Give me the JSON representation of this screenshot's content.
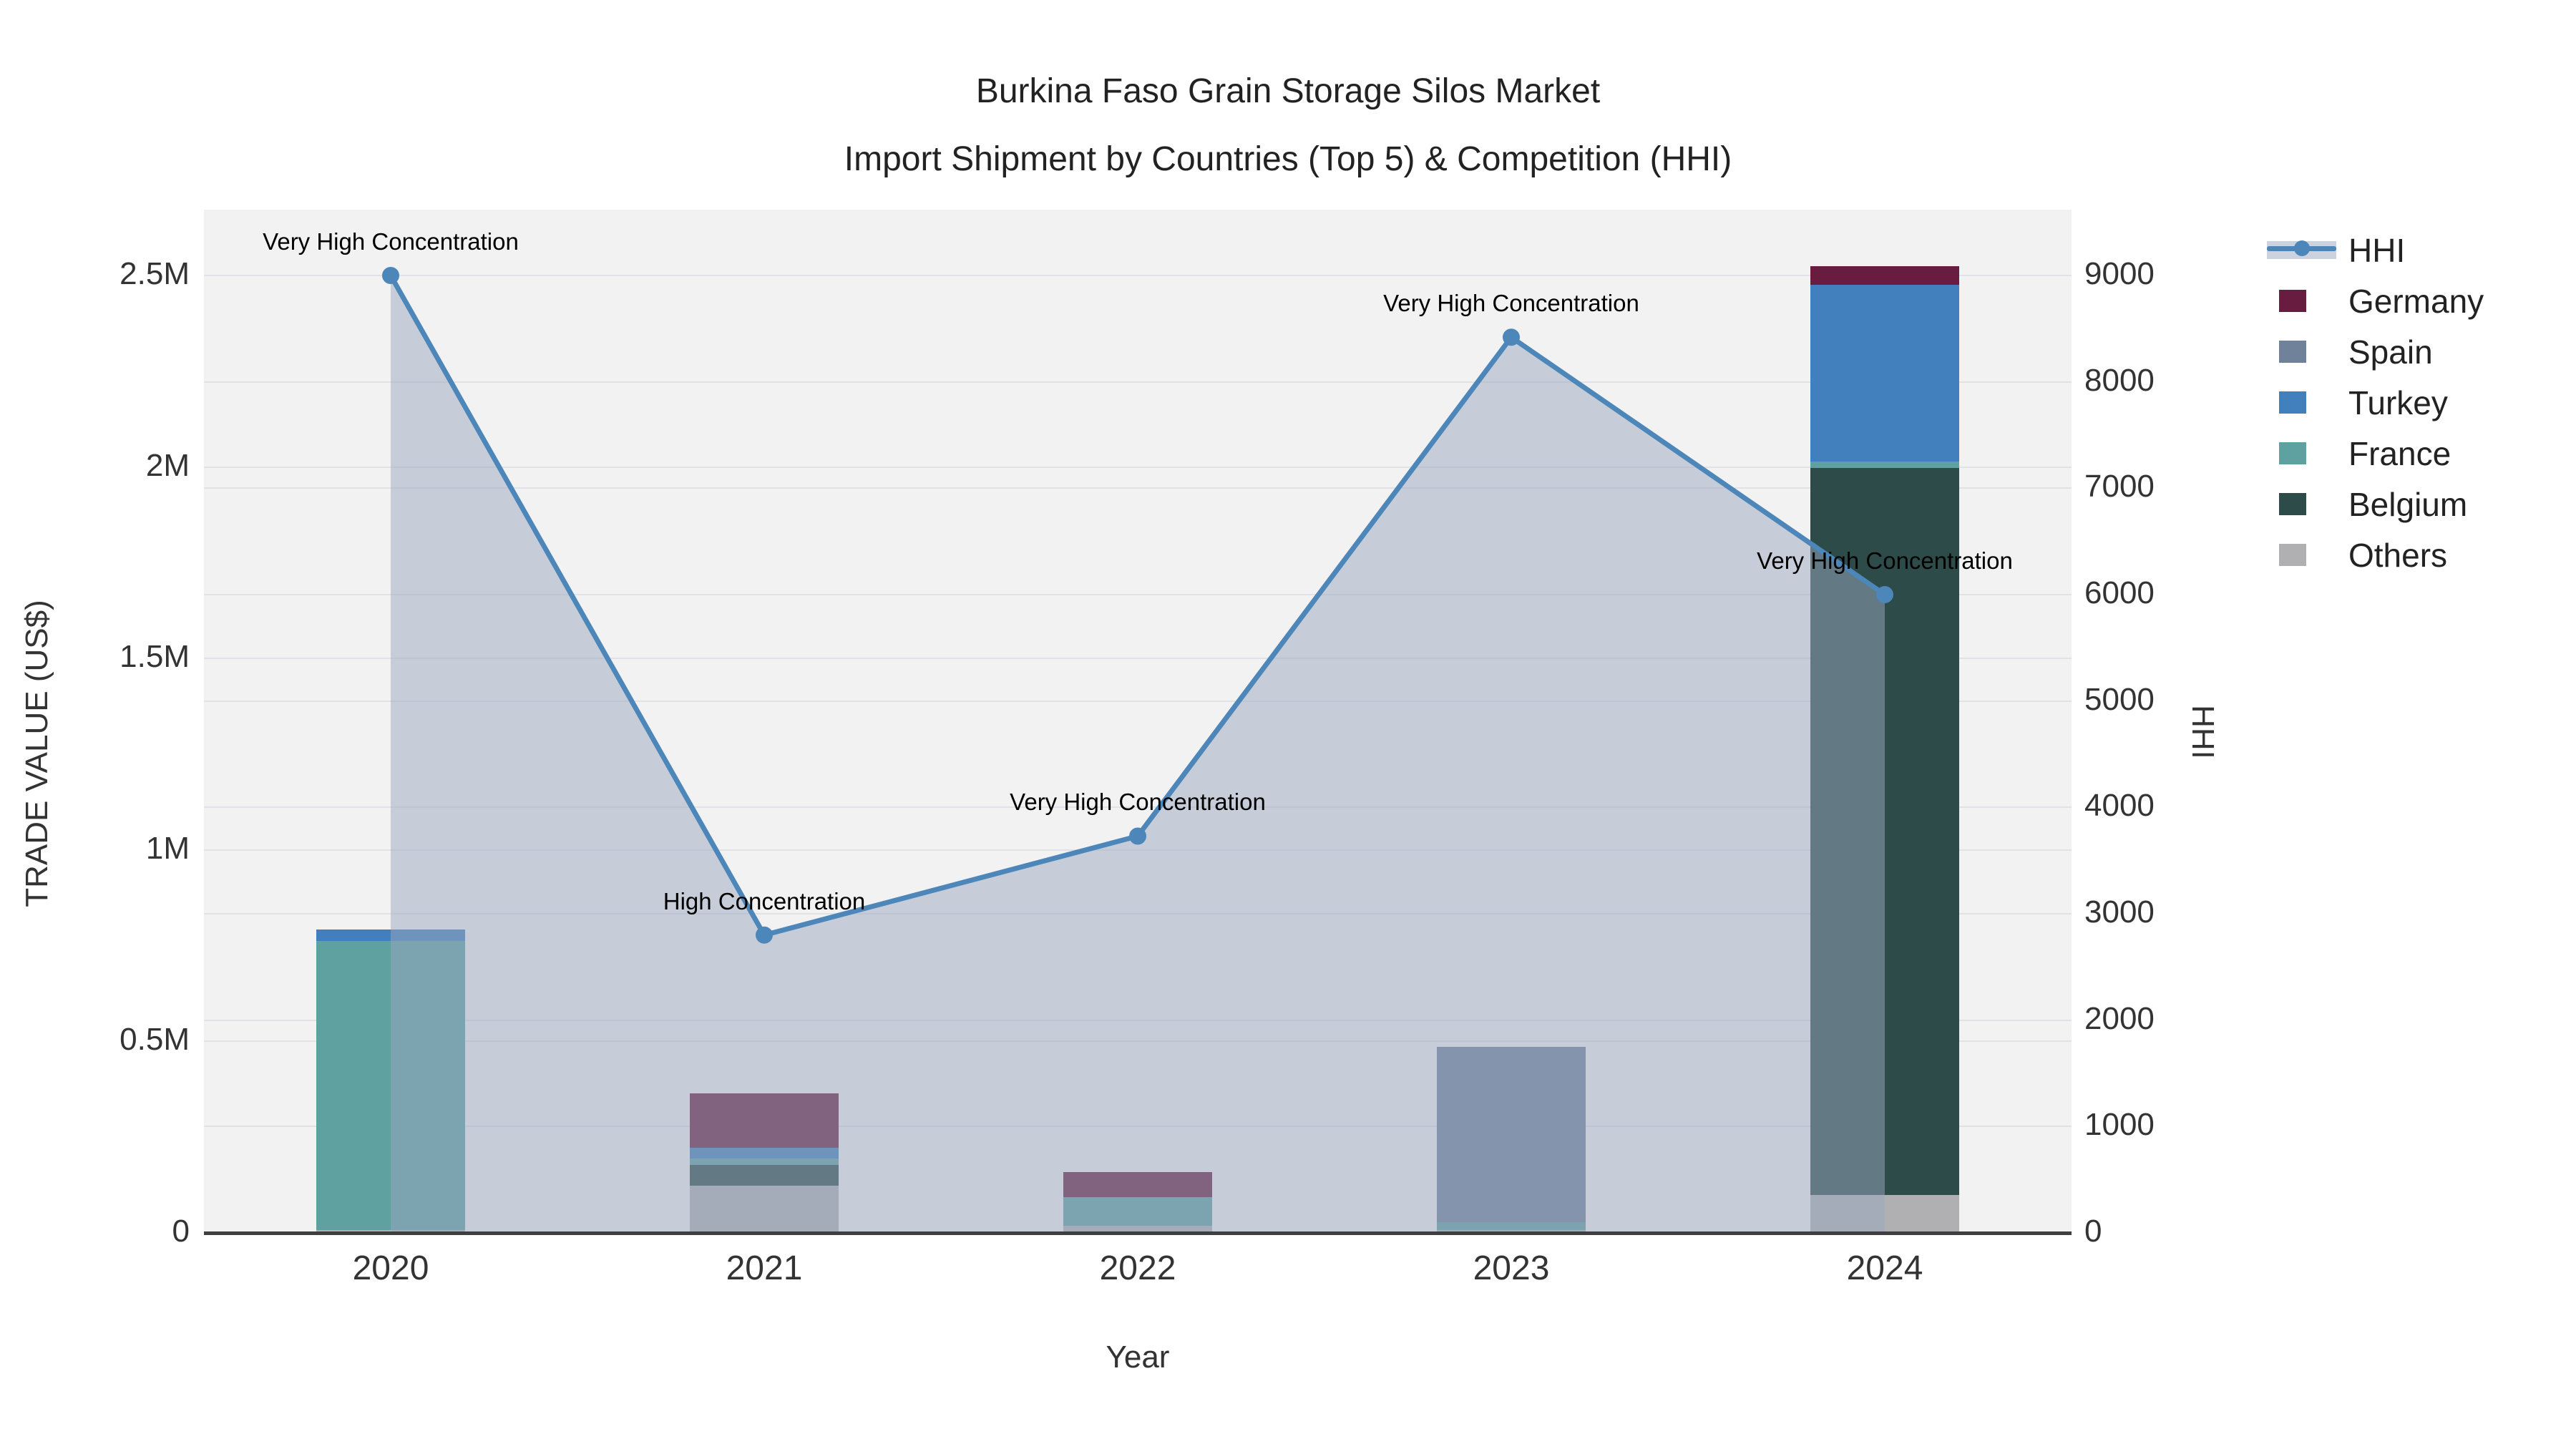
{
  "title": {
    "line1": "Burkina Faso Grain Storage Silos Market",
    "line2": "Import Shipment by Countries (Top 5) & Competition (HHI)"
  },
  "axes": {
    "x": {
      "title": "Year",
      "tick_labels": [
        "2020",
        "2021",
        "2022",
        "2023",
        "2024"
      ]
    },
    "y_left": {
      "title": "TRADE VALUE (US$)",
      "ticks": [
        {
          "value": 0,
          "label": "0"
        },
        {
          "value": 500000,
          "label": "0.5M"
        },
        {
          "value": 1000000,
          "label": "1M"
        },
        {
          "value": 1500000,
          "label": "1.5M"
        },
        {
          "value": 2000000,
          "label": "2M"
        },
        {
          "value": 2500000,
          "label": "2.5M"
        }
      ],
      "max": 2672000
    },
    "y_right": {
      "title": "HHI",
      "ticks": [
        {
          "value": 0,
          "label": "0"
        },
        {
          "value": 1000,
          "label": "1000"
        },
        {
          "value": 2000,
          "label": "2000"
        },
        {
          "value": 3000,
          "label": "3000"
        },
        {
          "value": 4000,
          "label": "4000"
        },
        {
          "value": 5000,
          "label": "5000"
        },
        {
          "value": 6000,
          "label": "6000"
        },
        {
          "value": 7000,
          "label": "7000"
        },
        {
          "value": 8000,
          "label": "8000"
        },
        {
          "value": 9000,
          "label": "9000"
        }
      ],
      "max": 9619
    }
  },
  "colors": {
    "hhi_line": "#4d86b8",
    "hhi_fill": "rgba(154,168,192,0.5)",
    "germany": "#681c3f",
    "spain": "#70819a",
    "turkey": "#4280bd",
    "france": "#5fa1a1",
    "belgium": "#2d4b49",
    "others": "#b0b0b2",
    "plot_bg": "#f2f2f3",
    "gridline": "#e1e2e5",
    "axis_line": "#3f3f3f"
  },
  "legend": [
    {
      "name": "HHI",
      "type": "line",
      "color": "#4d86b8"
    },
    {
      "name": "Germany",
      "type": "swatch",
      "color": "#681c3f"
    },
    {
      "name": "Spain",
      "type": "swatch",
      "color": "#70819a"
    },
    {
      "name": "Turkey",
      "type": "swatch",
      "color": "#4280bd"
    },
    {
      "name": "France",
      "type": "swatch",
      "color": "#5fa1a1"
    },
    {
      "name": "Belgium",
      "type": "swatch",
      "color": "#2d4b49"
    },
    {
      "name": "Others",
      "type": "swatch",
      "color": "#b0b0b2"
    }
  ],
  "chart_data": {
    "type": "bar",
    "subtype": "stacked-bar-with-line",
    "title": "Burkina Faso Grain Storage Silos Market — Import Shipment by Countries (Top 5) & Competition (HHI)",
    "xlabel": "Year",
    "ylabel_left": "TRADE VALUE (US$)",
    "ylabel_right": "HHI",
    "categories": [
      "2020",
      "2021",
      "2022",
      "2023",
      "2024"
    ],
    "stack_order_bottom_to_top": [
      "Others",
      "Belgium",
      "France",
      "Turkey",
      "Spain",
      "Germany"
    ],
    "series": [
      {
        "name": "Others",
        "axis": "left",
        "color": "#b0b0b2",
        "values": [
          8000,
          123000,
          19000,
          8000,
          99000
        ]
      },
      {
        "name": "Belgium",
        "axis": "left",
        "color": "#2d4b49",
        "values": [
          0,
          55000,
          0,
          0,
          1898000
        ]
      },
      {
        "name": "France",
        "axis": "left",
        "color": "#5fa1a1",
        "values": [
          755000,
          16000,
          74000,
          20000,
          17000
        ]
      },
      {
        "name": "Turkey",
        "axis": "left",
        "color": "#4280bd",
        "values": [
          30000,
          28000,
          0,
          0,
          462000
        ]
      },
      {
        "name": "Spain",
        "axis": "left",
        "color": "#70819a",
        "values": [
          0,
          0,
          0,
          457000,
          0
        ]
      },
      {
        "name": "Germany",
        "axis": "left",
        "color": "#681c3f",
        "values": [
          0,
          142000,
          65000,
          0,
          48000
        ]
      }
    ],
    "bar_totals": [
      793000,
      364000,
      158000,
      485000,
      2524000
    ],
    "line_series": {
      "name": "HHI",
      "axis": "right",
      "color": "#4d86b8",
      "fill_to_zero": true,
      "fill_color": "rgba(154,168,192,0.5)",
      "values": [
        9000,
        2800,
        3730,
        8420,
        6000
      ]
    },
    "annotations": [
      {
        "category": "2020",
        "text": "Very High Concentration"
      },
      {
        "category": "2021",
        "text": "High Concentration"
      },
      {
        "category": "2022",
        "text": "Very High Concentration"
      },
      {
        "category": "2023",
        "text": "Very High Concentration"
      },
      {
        "category": "2024",
        "text": "Very High Concentration"
      }
    ],
    "ylim_left": [
      0,
      2672000
    ],
    "ylim_right": [
      0,
      9619
    ],
    "grid": true,
    "legend_position": "right"
  }
}
